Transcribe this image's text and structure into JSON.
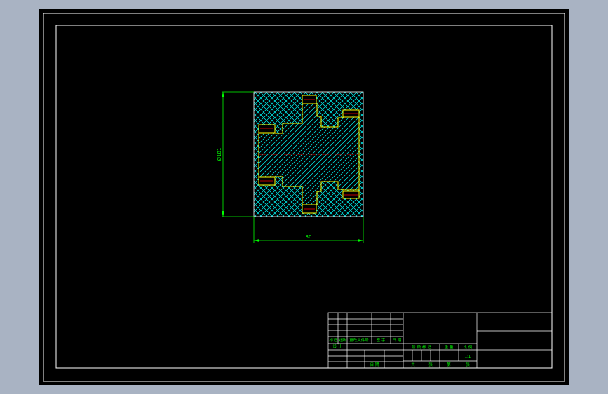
{
  "drawing": {
    "background": "#000000",
    "frame_color": "#ffffff",
    "part_outline_color": "#ffff00",
    "dimension_color": "#00ff00",
    "hatch_color": "#00ffff",
    "centerline_color": "#ff0000",
    "dimensions": {
      "vertical": "Ø181",
      "horizontal": "80"
    }
  },
  "title_block": {
    "revision_headers": [
      "标记",
      "处数",
      "更改文件号",
      "签 字",
      "日 期"
    ],
    "row_designer": "设 计",
    "row_approval": "日 期",
    "stage_label": "阶 段 标 记",
    "weight_label": "重 量",
    "scale_label": "比 例",
    "scale_value": "1:1",
    "sheet_total_label": "共",
    "sheet_total_unit": "张",
    "sheet_no_label": "第",
    "sheet_no_unit": "张"
  }
}
